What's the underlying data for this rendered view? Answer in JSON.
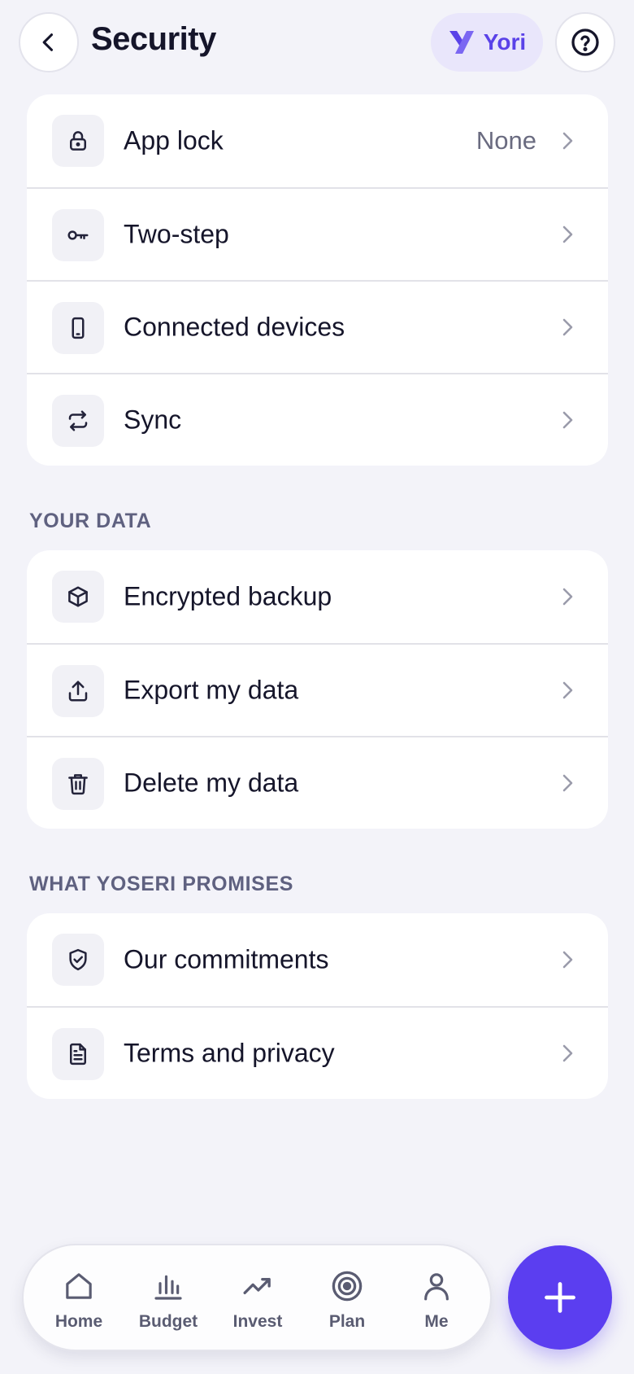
{
  "header": {
    "title": "Security",
    "brand_name": "Yori",
    "back_icon": "chevron-left-icon",
    "help_icon": "question-circle-icon"
  },
  "security_items": [
    {
      "label": "App lock",
      "value": "None",
      "icon": "lock-icon"
    },
    {
      "label": "Two-step",
      "value": "",
      "icon": "key-icon"
    },
    {
      "label": "Connected devices",
      "value": "",
      "icon": "phone-icon"
    },
    {
      "label": "Sync",
      "value": "",
      "icon": "sync-icon"
    }
  ],
  "your_data": {
    "title": "YOUR DATA",
    "items": [
      {
        "label": "Encrypted backup",
        "icon": "box-icon"
      },
      {
        "label": "Export my data",
        "icon": "upload-icon"
      },
      {
        "label": "Delete my data",
        "icon": "trash-icon"
      }
    ]
  },
  "promises": {
    "title": "WHAT YOSERI PROMISES",
    "items": [
      {
        "label": "Our commitments",
        "icon": "shield-check-icon"
      },
      {
        "label": "Terms and privacy",
        "icon": "document-icon"
      }
    ]
  },
  "nav": {
    "items": [
      {
        "label": "Home",
        "icon": "home-icon"
      },
      {
        "label": "Budget",
        "icon": "bar-chart-icon"
      },
      {
        "label": "Invest",
        "icon": "trending-up-icon"
      },
      {
        "label": "Plan",
        "icon": "target-icon"
      },
      {
        "label": "Me",
        "icon": "user-icon"
      }
    ]
  },
  "fab": {
    "icon": "plus-icon"
  },
  "colors": {
    "accent": "#5b3ef0",
    "brand_pill_bg": "#e9e6fb",
    "background": "#f3f3f9",
    "text_primary": "#15152a",
    "text_secondary": "#6a6b80",
    "section_title": "#5f6180"
  }
}
